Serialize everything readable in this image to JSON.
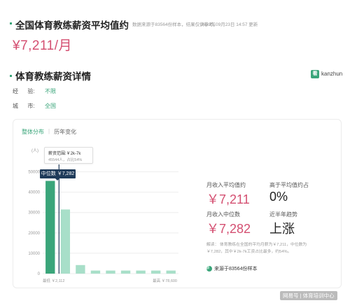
{
  "header": {
    "title": "全国体育教练薪资平均值约",
    "meta": "数据来源于83564份样本，结果仅供参考。",
    "updated": "2023年09月23日 14:57 更新",
    "salary": "¥7,211/月"
  },
  "details": {
    "title": "体育教练薪资详情",
    "logo_mark": "看",
    "logo_text": "kanzhun",
    "experience_label": "经      验:",
    "experience_value": "不限",
    "city_label": "城      市:",
    "city_value": "全国"
  },
  "panel": {
    "tabs": [
      "整体分布",
      "历年变化"
    ],
    "tooltip_title": "薪资范围:￥2k-7k",
    "tooltip_sub": "45544人，占比54%",
    "median_tag": "中位数 ￥7,282",
    "min_label": "最低 ￥2,112",
    "max_label": "最高 ￥78,600",
    "stats": {
      "avg_label": "月收入平均值约",
      "avg_value": "￥7,211",
      "above_label": "高于平均值约占",
      "above_value": "0%",
      "median_label": "月收入中位数",
      "median_value": "￥7,282",
      "trend_label": "近半年趋势",
      "trend_value": "上涨"
    },
    "note_line1": "解读：  体育教练在全国的平均月薪为￥7,211，中位数为",
    "note_line2": "￥7,282，其中￥2k-7k工资占比最多，约54%。",
    "source": "来源于83564份样本"
  },
  "chart_data": {
    "type": "bar",
    "ylabel": "(人)",
    "yticks": [
      0,
      10000,
      20000,
      30000,
      40000,
      50000
    ],
    "ylim": [
      0,
      55000
    ],
    "values": [
      45544,
      31500,
      4200,
      1500,
      1500,
      1500,
      1500,
      1500,
      1500
    ],
    "highlight_index": 0,
    "colors": {
      "highlight": "#3aa57a",
      "normal": "#a8dfc9",
      "grid": "#eeeeee"
    }
  },
  "watermark": "网易号 | 体育培训中心"
}
